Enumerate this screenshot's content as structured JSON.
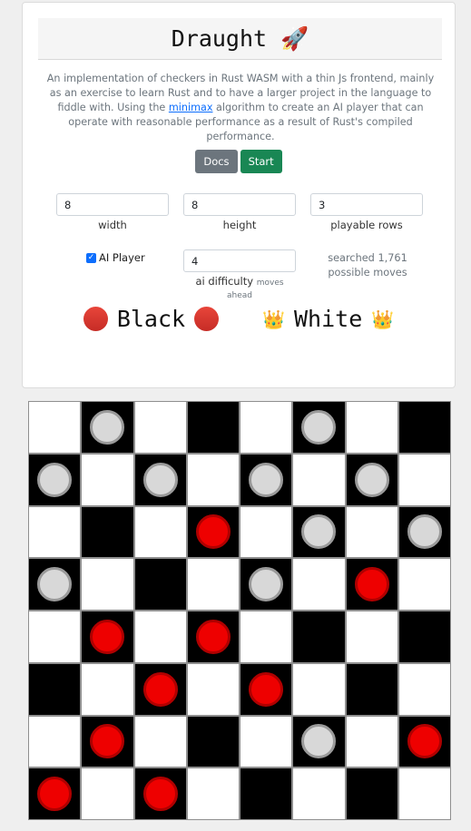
{
  "header": {
    "title": "Draught 🚀",
    "description_before_link": "An implementation of checkers in Rust WASM with a thin Js frontend, mainly as an exercise to learn Rust and to have a larger project in the language to fiddle with. Using the ",
    "link_text": "minimax",
    "description_after_link": " algorithm to create an AI player that can operate with reasonable performance as a result of Rust's compiled performance."
  },
  "buttons": {
    "docs": "Docs",
    "start": "Start"
  },
  "settings": {
    "width": {
      "value": "8",
      "label": "width"
    },
    "height": {
      "value": "8",
      "label": "height"
    },
    "playable_rows": {
      "value": "3",
      "label": "playable rows"
    },
    "ai_player": {
      "label": "AI Player",
      "checked": true
    },
    "ai_difficulty": {
      "value": "4",
      "label": "ai difficulty",
      "hint": "moves ahead"
    },
    "searched_text": "searched 1,761 possible moves"
  },
  "players": {
    "black": {
      "label": "Black",
      "icon": "red-circle-icon",
      "active": true
    },
    "white": {
      "label": "White",
      "icon": "crown-icon"
    }
  },
  "board": {
    "rows": 8,
    "cols": 8,
    "colors": {
      "dark": "#000000",
      "light": "#ffffff",
      "red_piece": "#ee0000",
      "white_piece": "#d8d8d8"
    },
    "cells": [
      [
        "",
        "W",
        "",
        "",
        "",
        "W",
        "",
        ""
      ],
      [
        "W",
        "",
        "W",
        "",
        "W",
        "",
        "W",
        ""
      ],
      [
        "",
        "",
        "",
        "R",
        "",
        "W",
        "",
        "W"
      ],
      [
        "W",
        "",
        "",
        "",
        "W",
        "",
        "R",
        ""
      ],
      [
        "",
        "R",
        "",
        "R",
        "",
        "",
        "",
        ""
      ],
      [
        "",
        "",
        "R",
        "",
        "R",
        "",
        "",
        ""
      ],
      [
        "",
        "R",
        "",
        "",
        "",
        "W",
        "",
        "R"
      ],
      [
        "R",
        "",
        "R",
        "",
        "",
        "",
        "",
        ""
      ]
    ]
  }
}
